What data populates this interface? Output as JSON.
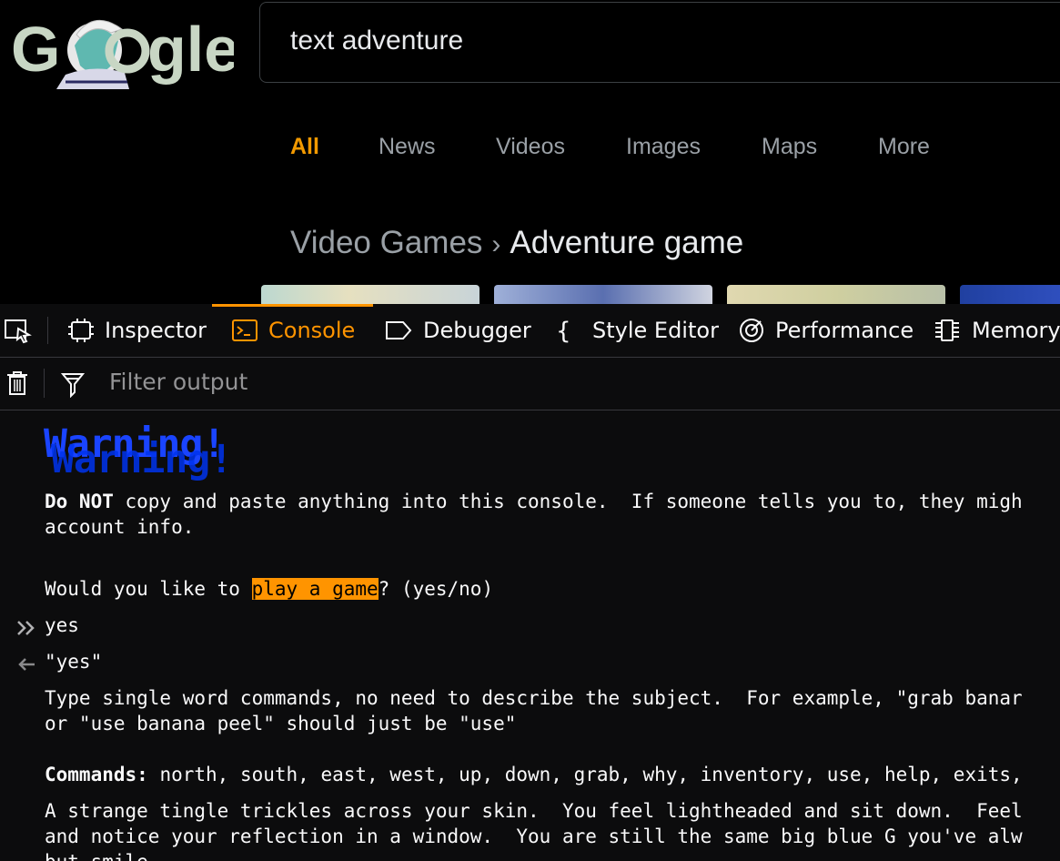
{
  "google": {
    "logo_text": "Google",
    "search_query": "text adventure",
    "tabs": [
      {
        "label": "All",
        "active": true
      },
      {
        "label": "News",
        "active": false
      },
      {
        "label": "Videos",
        "active": false
      },
      {
        "label": "Images",
        "active": false
      },
      {
        "label": "Maps",
        "active": false
      },
      {
        "label": "More",
        "active": false
      }
    ],
    "breadcrumb": {
      "parent": "Video Games",
      "separator": "›",
      "current": "Adventure game"
    },
    "accent_color": "#f29900"
  },
  "devtools": {
    "tabs": [
      {
        "label": "Inspector",
        "icon": "inspector-icon",
        "active": false
      },
      {
        "label": "Console",
        "icon": "console-icon",
        "active": true
      },
      {
        "label": "Debugger",
        "icon": "debugger-icon",
        "active": false
      },
      {
        "label": "Style Editor",
        "icon": "braces-icon",
        "active": false
      },
      {
        "label": "Performance",
        "icon": "performance-icon",
        "active": false
      },
      {
        "label": "Memory",
        "icon": "memory-icon",
        "active": false
      }
    ],
    "filter_placeholder": "Filter output",
    "active_color": "#ff9400",
    "console": {
      "warning": "Warning!",
      "warning_color": "#1a44ff",
      "notice_bold": "Do NOT",
      "notice_line1": " copy and paste anything into this console.  If someone tells you to, they migh",
      "notice_line2": "account info.",
      "question_before": "Would you like to ",
      "question_highlight": "play a game",
      "question_after": "? (yes/no)",
      "input": "yes",
      "result": "\"yes\"",
      "instr_line1": "Type single word commands, no need to describe the subject.  For example, \"grab banar",
      "instr_line2": "or \"use banana peel\" should just be \"use\"",
      "commands_label": "Commands:",
      "commands_list": " north, south, east, west, up, down, grab, why, inventory, use, help, exits,",
      "story_line1": "A strange tingle trickles across your skin.  You feel lightheaded and sit down.  Feel",
      "story_line2": "and notice your reflection in a window.  You are still the same big blue G you've alw",
      "story_line3": "but smile"
    }
  }
}
